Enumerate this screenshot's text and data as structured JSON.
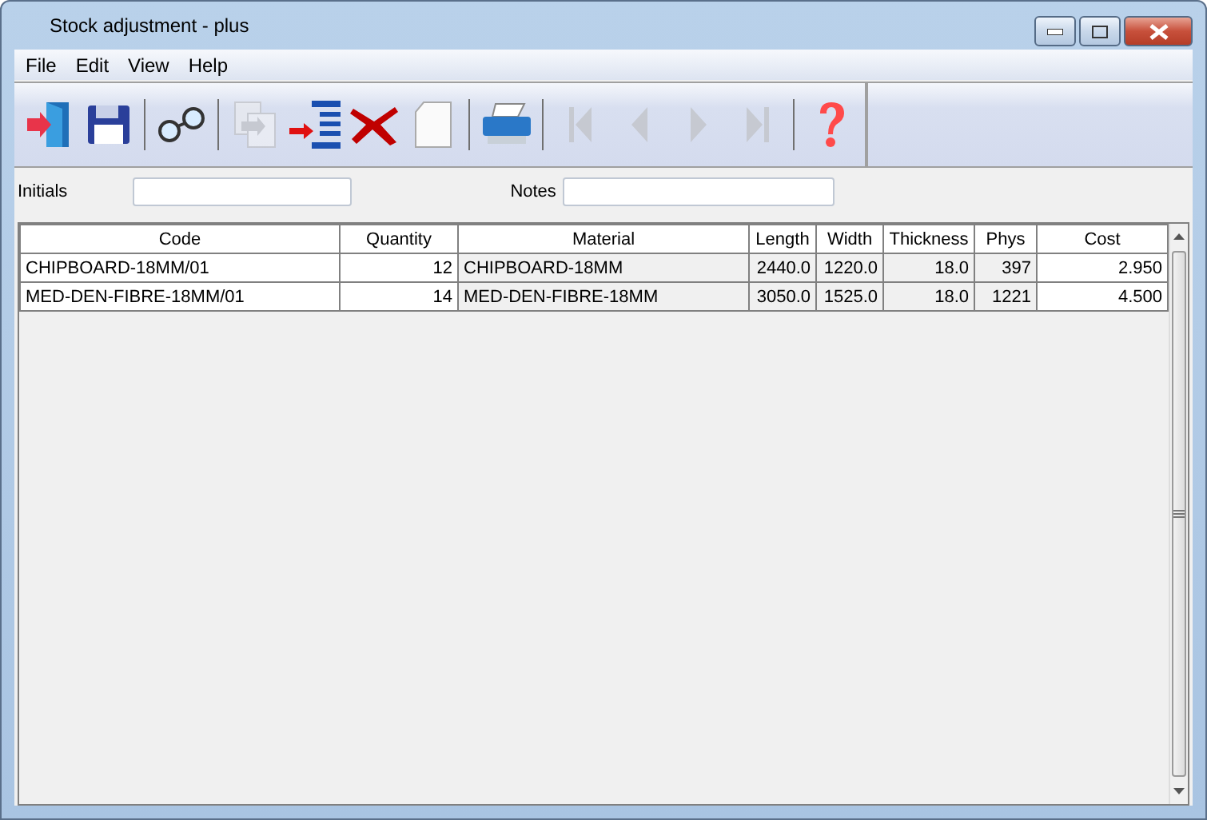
{
  "window": {
    "title": "Stock adjustment - plus"
  },
  "menu": [
    "File",
    "Edit",
    "View",
    "Help"
  ],
  "toolbar": [
    {
      "kind": "exit",
      "disabled": false
    },
    {
      "kind": "save",
      "disabled": false
    },
    {
      "kind": "separator"
    },
    {
      "kind": "view",
      "disabled": false
    },
    {
      "kind": "separator"
    },
    {
      "kind": "copy",
      "disabled": true
    },
    {
      "kind": "insert",
      "disabled": false
    },
    {
      "kind": "delete",
      "disabled": false
    },
    {
      "kind": "new",
      "disabled": false
    },
    {
      "kind": "separator"
    },
    {
      "kind": "print",
      "disabled": false
    },
    {
      "kind": "separator"
    },
    {
      "kind": "first",
      "disabled": true
    },
    {
      "kind": "prev",
      "disabled": true
    },
    {
      "kind": "next",
      "disabled": true
    },
    {
      "kind": "last",
      "disabled": true
    },
    {
      "kind": "separator"
    },
    {
      "kind": "help",
      "disabled": false
    }
  ],
  "fields": [
    {
      "label": "Initials"
    },
    {
      "label": "Notes"
    }
  ],
  "table": {
    "columns": [
      {
        "label": "Code",
        "editable": true,
        "kind": "text"
      },
      {
        "label": "Quantity",
        "editable": true,
        "kind": "number"
      },
      {
        "label": "Material",
        "editable": false,
        "kind": "text"
      },
      {
        "label": "Length",
        "editable": false,
        "kind": "number"
      },
      {
        "label": "Width",
        "editable": false,
        "kind": "number"
      },
      {
        "label": "Thickness",
        "editable": false,
        "kind": "number"
      },
      {
        "label": "Phys",
        "editable": false,
        "kind": "number"
      },
      {
        "label": "Cost",
        "editable": true,
        "kind": "number"
      }
    ],
    "rows": [
      [
        "CHIPBOARD-18MM/01",
        "12",
        "CHIPBOARD-18MM",
        "2440.0",
        "1220.0",
        "18.0",
        "397",
        "2.950"
      ],
      [
        "MED-DEN-FIBRE-18MM/01",
        "14",
        "MED-DEN-FIBRE-18MM",
        "3050.0",
        "1525.0",
        "18.0",
        "1221",
        "4.500"
      ]
    ]
  }
}
